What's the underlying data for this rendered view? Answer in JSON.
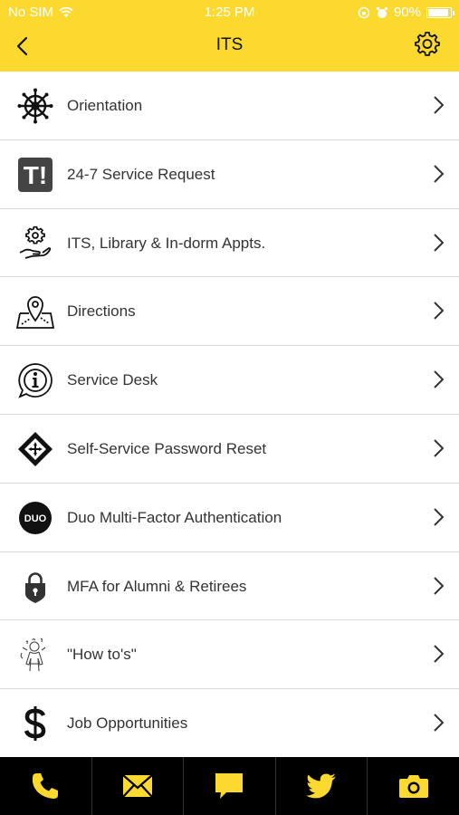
{
  "status_bar": {
    "carrier": "No SIM",
    "time": "1:25 PM",
    "battery": "90%",
    "battery_level": 0.9
  },
  "header": {
    "title": "ITS"
  },
  "colors": {
    "accent": "#FCD92E",
    "tab_bar": "#000000",
    "divider": "#d9d9d9"
  },
  "menu": {
    "items": [
      {
        "label": "Orientation",
        "icon": "ship-wheel-icon"
      },
      {
        "label": "24-7 Service Request",
        "icon": "t-exclaim-icon"
      },
      {
        "label": "ITS, Library & In-dorm Appts.",
        "icon": "gear-hand-icon"
      },
      {
        "label": "Directions",
        "icon": "map-pin-icon"
      },
      {
        "label": "Service Desk",
        "icon": "info-bubble-icon"
      },
      {
        "label": "Self-Service Password Reset",
        "icon": "diamond-arrows-icon"
      },
      {
        "label": "Duo Multi-Factor Authentication",
        "icon": "duo-logo-icon"
      },
      {
        "label": "MFA for Alumni & Retirees",
        "icon": "lock-shield-icon"
      },
      {
        "label": "\"How to's\"",
        "icon": "sketch-person-icon"
      },
      {
        "label": "Job Opportunities",
        "icon": "dollar-icon"
      }
    ]
  },
  "tabs": [
    {
      "icon": "phone-icon"
    },
    {
      "icon": "mail-icon"
    },
    {
      "icon": "chat-icon"
    },
    {
      "icon": "twitter-icon"
    },
    {
      "icon": "camera-icon"
    }
  ],
  "duo_text": "DUO"
}
